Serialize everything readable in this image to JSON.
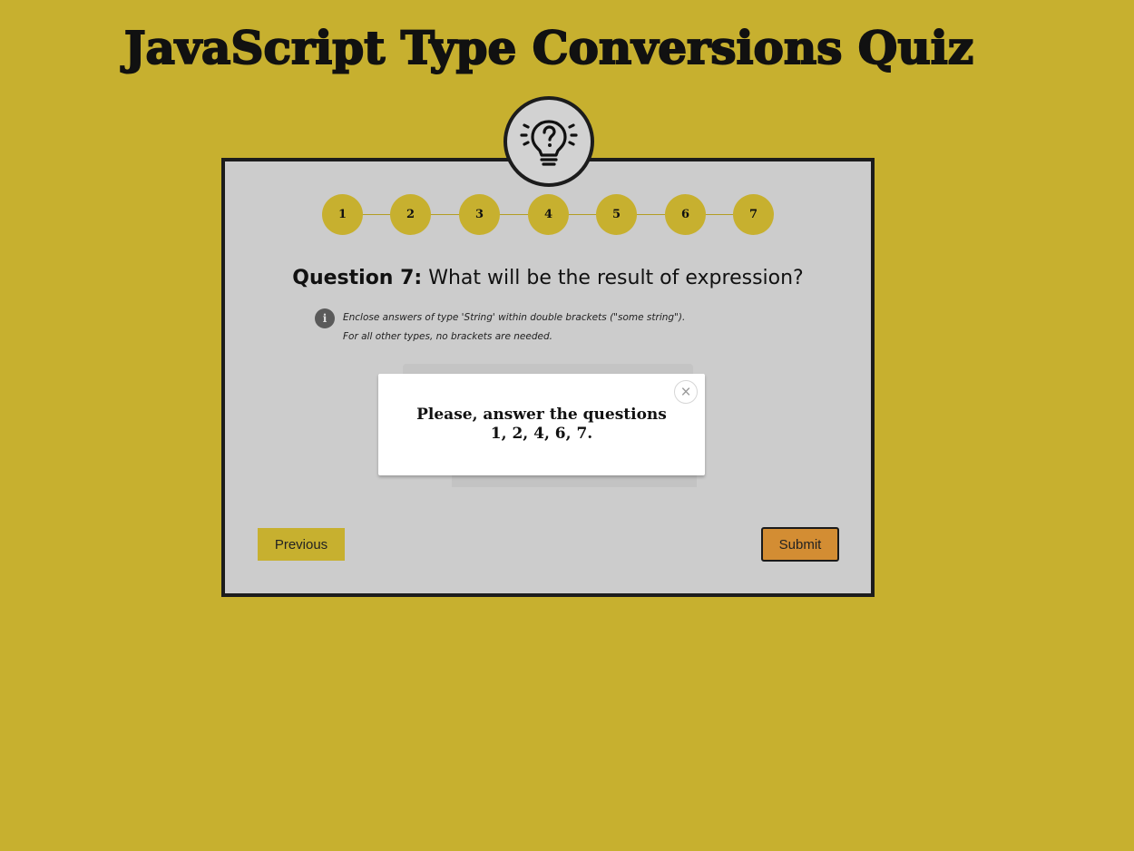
{
  "header": {
    "title": "JavaScript Type Conversions Quiz"
  },
  "badge": {
    "icon": "lightbulb-question-icon"
  },
  "stepper": {
    "steps": [
      "1",
      "2",
      "3",
      "4",
      "5",
      "6",
      "7"
    ]
  },
  "question": {
    "number_label": "Question 7:",
    "text": "What will be the result of expression?"
  },
  "hint": {
    "icon": "info-icon",
    "line1": "Enclose answers of type 'String' within double brackets (\"some string\").",
    "line2": "For all other types, no brackets are needed."
  },
  "buttons": {
    "previous": "Previous",
    "submit": "Submit"
  },
  "modal": {
    "close_glyph": "×",
    "message_line1": "Please, answer the questions",
    "message_line2": "1, 2, 4, 6, 7."
  },
  "colors": {
    "background": "#c7b02f",
    "card": "#cccccc",
    "submit": "#d38d33",
    "border": "#1c1c1c"
  }
}
